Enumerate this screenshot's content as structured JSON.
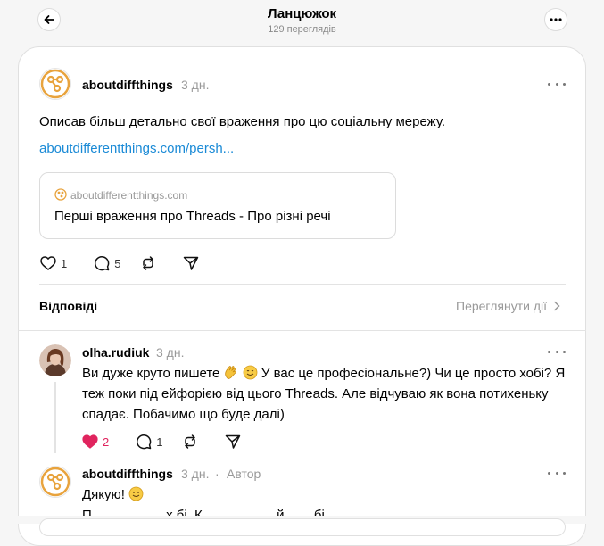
{
  "header": {
    "title": "Ланцюжок",
    "views": "129 переглядів"
  },
  "post": {
    "username": "aboutdiffthings",
    "time": "3 дн.",
    "text": "Описав більш детально свої враження про цю соціальну мережу.",
    "link": "aboutdifferentthings.com/persh...",
    "preview": {
      "domain": "aboutdifferentthings.com",
      "title": "Перші враження про Threads - Про різні речі"
    },
    "likes": "1",
    "comments": "5"
  },
  "replies": {
    "label": "Відповіді",
    "view_activity": "Переглянути дії"
  },
  "reply1": {
    "username": "olha.rudiuk",
    "time": "3 дн.",
    "text_a": "Ви дуже круто пишете",
    "text_b": "У вас це професіональне?) Чи це просто хобі? Я",
    "line2": "теж поки під ейфорією від цього Threads. Але відчуваю як вона потихеньку",
    "line3": "спадає. Побачимо що буде далі)",
    "likes": "2",
    "comments": "1",
    "like_color": "#e0245e"
  },
  "reply2": {
    "username": "aboutdiffthings",
    "time": "3 дн.",
    "separator": "·",
    "author_tag": "Автор",
    "text": "Дякую!",
    "partial": "П                    х бі  К                    й        бі"
  },
  "colors": {
    "accent_link": "#1a8ad6",
    "logo": "#e8a33d"
  }
}
